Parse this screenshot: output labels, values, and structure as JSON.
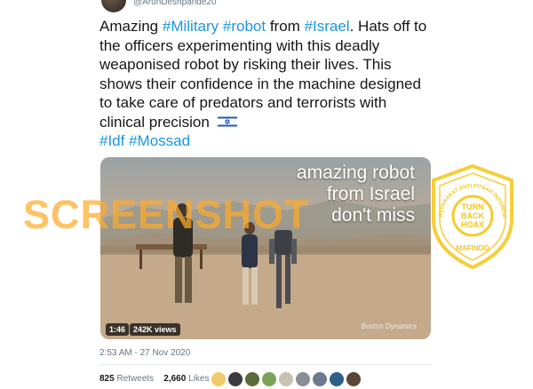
{
  "tweet": {
    "handle": "@ArunDeshpande20",
    "text_parts": [
      {
        "t": "Amazing ",
        "tag": false
      },
      {
        "t": "#Military",
        "tag": true
      },
      {
        "t": " ",
        "tag": false
      },
      {
        "t": "#robot",
        "tag": true
      },
      {
        "t": " from ",
        "tag": false
      },
      {
        "t": "#Israel",
        "tag": true
      },
      {
        "t": ". Hats off to the  officers experimenting with this deadly weaponised robot by risking their lives. This shows their  confidence in the machine designed to take care of predators and terrorists with clinical precision ",
        "tag": false
      }
    ],
    "hashtags_line2": [
      "#Idf",
      "#Mossad"
    ],
    "flag_icon": "israel-flag-icon",
    "timestamp": "2:53 AM - 27 Nov 2020"
  },
  "media": {
    "overlay_lines": [
      "amazing robot",
      "from Israel",
      "don't miss"
    ],
    "duration": "1:46",
    "views": "242K views",
    "credit": "Boston Dynamics"
  },
  "watermark": "SCREENSHOT",
  "seal": {
    "top_text": "MASYARAKAT ANTI FITNAH INDONESIA",
    "bottom_text": "MAFINDO",
    "center_lines": [
      "TURN",
      "BACK",
      "HOAX"
    ],
    "color": "#f5c518"
  },
  "stats": {
    "retweets_count": "825",
    "retweets_label": "Retweets",
    "likes_count": "2,660",
    "likes_label": "Likes"
  },
  "likers": [
    "#f2c96b",
    "#3b3b3b",
    "#5c6b3a",
    "#7aa35a",
    "#c9c1b2",
    "#8a8f95",
    "#6b7b8f",
    "#2e5e8a",
    "#5a4638"
  ]
}
